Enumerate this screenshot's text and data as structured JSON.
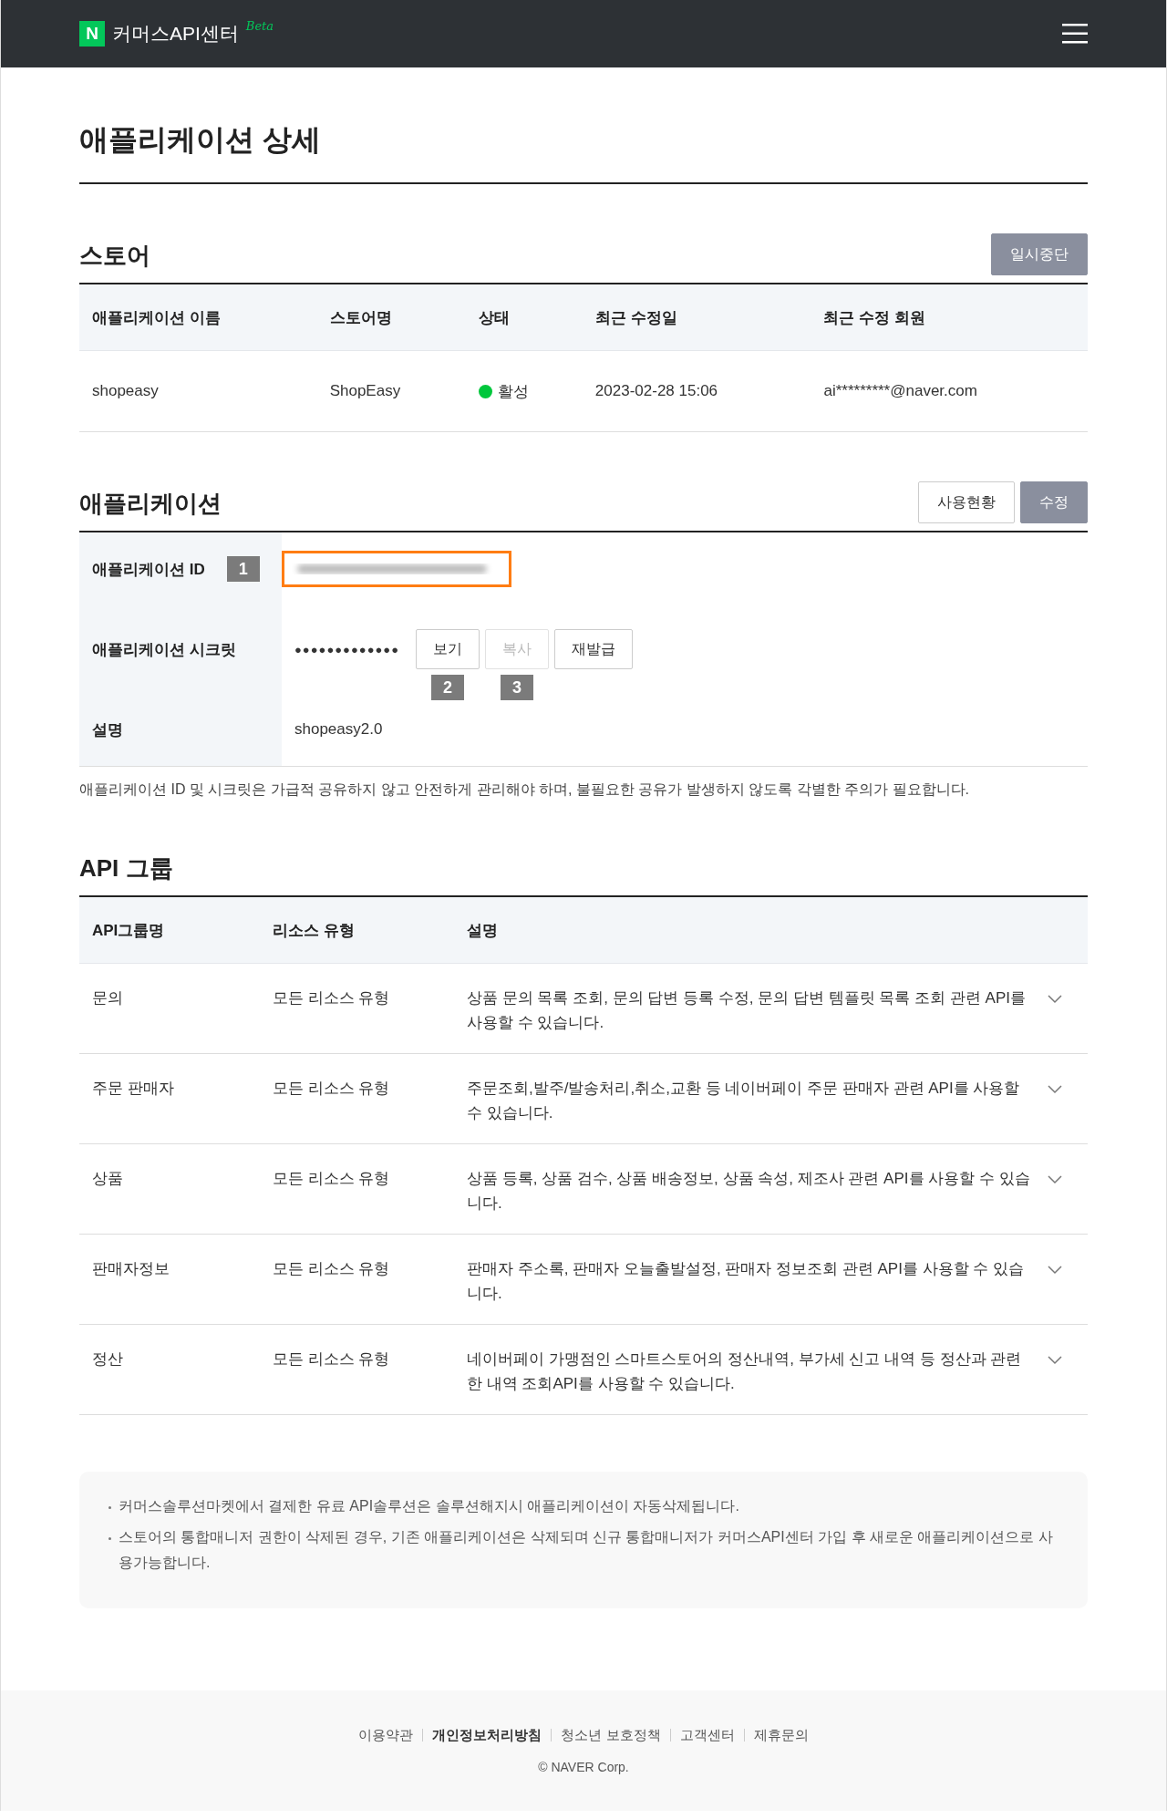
{
  "header": {
    "logo_letter": "N",
    "title": "커머스API센터",
    "badge": "Beta"
  },
  "page_title": "애플리케이션 상세",
  "store": {
    "heading": "스토어",
    "action": "일시중단",
    "columns": [
      "애플리케이션 이름",
      "스토어명",
      "상태",
      "최근 수정일",
      "최근 수정 회원"
    ],
    "row": {
      "app_name": "shopeasy",
      "store_name": "ShopEasy",
      "status": "활성",
      "color": "#00c73c",
      "modified": "2023-02-28 15:06",
      "modified_by": "ai*********@naver.com"
    }
  },
  "application": {
    "heading": "애플리케이션",
    "buttons": [
      {
        "label": "사용현황",
        "kind": "outline"
      },
      {
        "label": "수정",
        "kind": "filled"
      }
    ],
    "id_label": "애플리케이션 ID",
    "id_marker": "1",
    "secret_label": "애플리케이션 시크릿",
    "secret_value": "●●●●●●●●●●●●●",
    "secret_buttons": [
      {
        "label": "보기",
        "disabled": false,
        "marker": "2"
      },
      {
        "label": "복사",
        "disabled": true,
        "marker": "3"
      },
      {
        "label": "재발급",
        "disabled": false
      }
    ],
    "description_label": "설명",
    "description_value": "shopeasy2.0",
    "notice": "애플리케이션 ID 및 시크릿은 가급적 공유하지 않고 안전하게 관리해야 하며, 불필요한 공유가 발생하지 않도록 각별한 주의가 필요합니다."
  },
  "api_group": {
    "heading": "API 그룹",
    "columns": [
      "API그룹명",
      "리소스 유형",
      "설명"
    ],
    "rows": [
      {
        "name": "문의",
        "resource": "모든 리소스 유형",
        "description": "상품 문의 목록 조회, 문의 답변 등록 수정, 문의 답변 템플릿 목록 조회 관련 API를 사용할 수 있습니다.",
        "expanded": false
      },
      {
        "name": "주문 판매자",
        "resource": "모든 리소스 유형",
        "description": "주문조회,발주/발송처리,취소,교환 등 네이버페이 주문 판매자 관련 API를 사용할 수 있습니다.",
        "expanded": false
      },
      {
        "name": "상품",
        "resource": "모든 리소스 유형",
        "description": "상품 등록, 상품 검수, 상품 배송정보, 상품 속성, 제조사 관련 API를 사용할 수 있습니다.",
        "expanded": false
      },
      {
        "name": "판매자정보",
        "resource": "모든 리소스 유형",
        "description": "판매자 주소록, 판매자 오늘출발설정, 판매자 정보조회 관련 API를 사용할 수 있습니다.",
        "expanded": false
      },
      {
        "name": "정산",
        "resource": "모든 리소스 유형",
        "description": "네이버페이 가맹점인 스마트스토어의 정산내역, 부가세 신고 내역 등 정산과 관련한 내역 조회API를 사용할 수 있습니다.",
        "expanded": false
      }
    ]
  },
  "info_notes": [
    "커머스솔루션마켓에서 결제한 유료 API솔루션은 솔루션해지시 애플리케이션이 자동삭제됩니다.",
    "스토어의 통합매니저 권한이 삭제된 경우, 기존 애플리케이션은 삭제되며 신규 통합매니저가 커머스API센터 가입 후 새로운 애플리케이션으로 사용가능합니다."
  ],
  "footer": {
    "links": [
      {
        "label": "이용약관",
        "bold": false
      },
      {
        "label": "개인정보처리방침",
        "bold": true
      },
      {
        "label": "청소년 보호정책",
        "bold": false
      },
      {
        "label": "고객센터",
        "bold": false
      },
      {
        "label": "제휴문의",
        "bold": false
      }
    ],
    "copyright": "© NAVER Corp."
  }
}
